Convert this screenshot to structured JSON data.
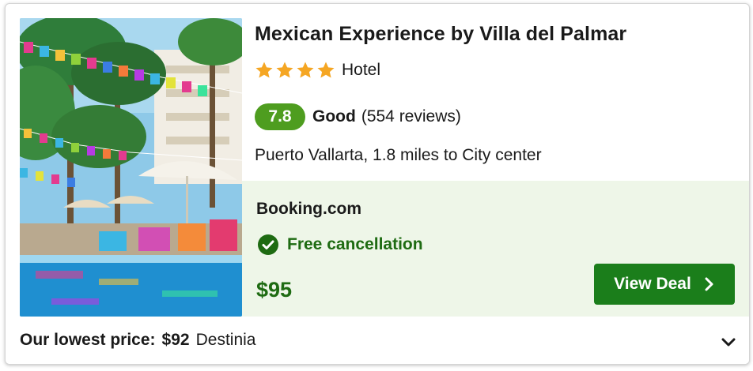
{
  "hotel": {
    "name": "Mexican Experience by Villa del Palmar",
    "star_count": 4,
    "type": "Hotel",
    "score": "7.8",
    "score_label": "Good",
    "review_count": "(554 reviews)",
    "location": "Puerto Vallarta, 1.8 miles to City center",
    "photo_icon": "hotel-photo"
  },
  "deal": {
    "provider": "Booking.com",
    "cancellation": "Free cancellation",
    "price": "$95",
    "button_label": "View Deal"
  },
  "lowest": {
    "label": "Our lowest price:",
    "price": "$92",
    "provider": "Destinia"
  },
  "colors": {
    "score_badge": "#4e9d1f",
    "deal_background": "#eef6e8",
    "accent_green": "#1e6b12",
    "button": "#1b7e1b",
    "star": "#f5a623"
  },
  "icons": {
    "star": "star-icon",
    "check": "check-circle-icon",
    "chevron_right": "chevron-right-icon",
    "chevron_down": "chevron-down-icon"
  }
}
